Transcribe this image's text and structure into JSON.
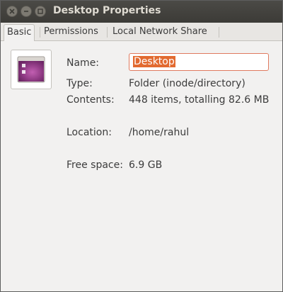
{
  "window": {
    "title": "Desktop Properties"
  },
  "titlebar_buttons": {
    "close": "close-icon",
    "minimize": "minimize-icon",
    "maximize": "maximize-icon"
  },
  "tabs": [
    {
      "label": "Basic",
      "active": true
    },
    {
      "label": "Permissions",
      "active": false
    },
    {
      "label": "Local Network Share",
      "active": false
    }
  ],
  "basic": {
    "icon": "folder-desktop-icon",
    "name_label": "Name:",
    "name_value": "Desktop",
    "type_label": "Type:",
    "type_value": "Folder (inode/directory)",
    "contents_label": "Contents:",
    "contents_value": "448 items, totalling 82.6 MB",
    "location_label": "Location:",
    "location_value": "/home/rahul",
    "freespace_label": "Free space:",
    "freespace_value": "6.9 GB"
  },
  "colors": {
    "titlebar": "#3c3b37",
    "selection": "#e26a30",
    "folder_purple": "#7b2a6e"
  }
}
